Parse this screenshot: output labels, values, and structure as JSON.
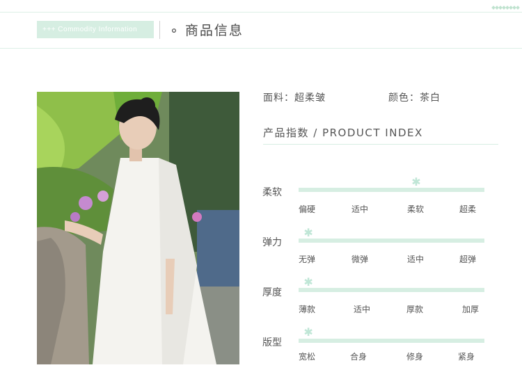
{
  "header": {
    "tag_label": "+++ Commodity Information",
    "title": "∘ 商品信息"
  },
  "fabric": {
    "label": "面料：超柔皱"
  },
  "color": {
    "label": "颜色：茶白"
  },
  "index": {
    "title": "产品指数 / PRODUCT INDEX",
    "rows": [
      {
        "label": "柔软",
        "options": [
          "偏硬",
          "适中",
          "柔软",
          "超柔"
        ],
        "level": 0.63
      },
      {
        "label": "弹力",
        "options": [
          "无弹",
          "微弹",
          "适中",
          "超弹"
        ],
        "level": 0.05
      },
      {
        "label": "厚度",
        "options": [
          "薄款",
          "适中",
          "厚款",
          "加厚"
        ],
        "level": 0.05
      },
      {
        "label": "版型",
        "options": [
          "宽松",
          "合身",
          "修身",
          "紧身"
        ],
        "level": 0.05
      }
    ]
  },
  "colors": {
    "accent": "#d6eee2",
    "star": "#bfe6d6",
    "text": "#555555"
  },
  "icons": {
    "marker": "star-icon"
  }
}
